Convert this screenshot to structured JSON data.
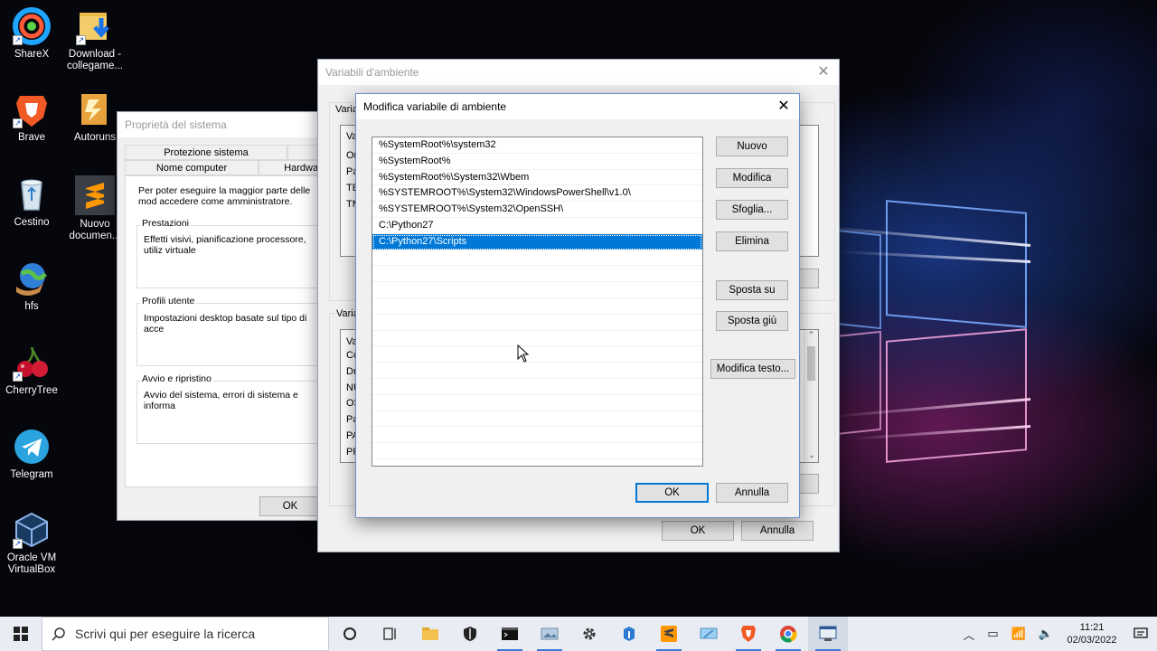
{
  "desktop": {
    "icons": [
      {
        "label": "ShareX",
        "icon": "sharex-icon"
      },
      {
        "label": "Download - collegame...",
        "icon": "folder-download-icon"
      },
      {
        "label": "Brave",
        "icon": "brave-icon"
      },
      {
        "label": "Autoruns",
        "icon": "autoruns-icon"
      },
      {
        "label": "Cestino",
        "icon": "recycle-bin-icon"
      },
      {
        "label": "Nuovo documen...",
        "icon": "sublime-icon"
      },
      {
        "label": "hfs",
        "icon": "hfs-icon"
      },
      {
        "label": "CherryTree",
        "icon": "cherrytree-icon"
      },
      {
        "label": "Telegram",
        "icon": "telegram-icon"
      },
      {
        "label": "Oracle VM VirtualBox",
        "icon": "virtualbox-icon"
      }
    ]
  },
  "system_props": {
    "title": "Proprietà del sistema",
    "tabs": [
      "Protezione sistema",
      "Nome computer",
      "Hardwar"
    ],
    "intro": "Per poter eseguire la maggior parte delle mod accedere come amministratore.",
    "groups": [
      {
        "label": "Prestazioni",
        "text": "Effetti visivi, pianificazione processore, utiliz virtuale"
      },
      {
        "label": "Profili utente",
        "text": "Impostazioni desktop basate sul tipo di acce"
      },
      {
        "label": "Avvio e ripristino",
        "text": "Avvio del sistema, errori di sistema e informa"
      }
    ],
    "ok_label": "OK"
  },
  "env_vars": {
    "title": "Variabili d'ambiente",
    "user_section_label": "Varia",
    "user_header": "Va",
    "user_rows": [
      "On",
      "Pa",
      "TE",
      "TM"
    ],
    "system_section_label": "Varia",
    "system_header": "Va",
    "system_rows": [
      "Co",
      "Dr",
      "NU",
      "OS",
      "Pa",
      "PA",
      "PR"
    ],
    "ok_label": "OK",
    "cancel_label": "Annulla"
  },
  "edit_dialog": {
    "title": "Modifica variabile di ambiente",
    "entries": [
      "%SystemRoot%\\system32",
      "%SystemRoot%",
      "%SystemRoot%\\System32\\Wbem",
      "%SYSTEMROOT%\\System32\\WindowsPowerShell\\v1.0\\",
      "%SYSTEMROOT%\\System32\\OpenSSH\\",
      "C:\\Python27",
      "C:\\Python27\\Scripts"
    ],
    "selected_index": 6,
    "buttons": {
      "new": "Nuovo",
      "edit": "Modifica",
      "browse": "Sfoglia...",
      "delete": "Elimina",
      "move_up": "Sposta su",
      "move_down": "Sposta giù",
      "edit_text": "Modifica testo...",
      "ok": "OK",
      "cancel": "Annulla"
    }
  },
  "taskbar": {
    "search_placeholder": "Scrivi qui per eseguire la ricerca",
    "apps": [
      "task-view-icon",
      "file-explorer-icon",
      "security-icon",
      "terminal-icon",
      "photos-icon",
      "settings-icon",
      "teams-icon",
      "sublime-icon",
      "remote-desktop-icon",
      "brave-icon",
      "chrome-icon",
      "system-props-icon"
    ],
    "time": "11:21",
    "date": "02/03/2022"
  },
  "colors": {
    "accent": "#0078d7",
    "selection": "#0078d7",
    "taskbar": "#e9edf3"
  }
}
